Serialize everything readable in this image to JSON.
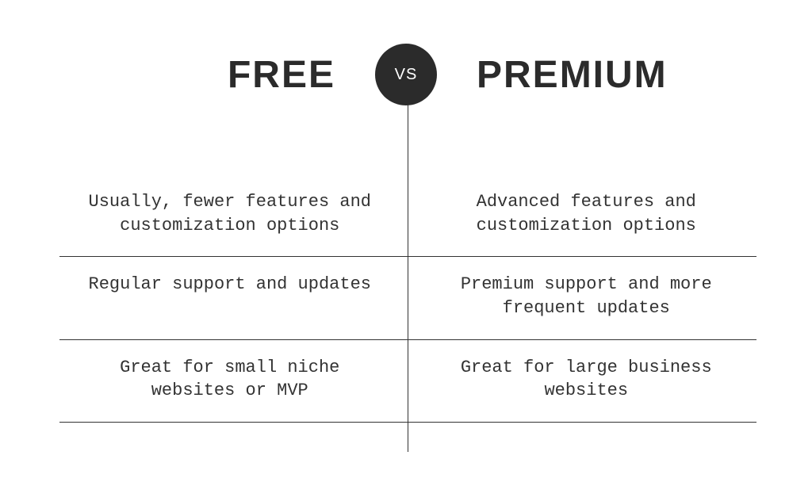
{
  "header": {
    "left": "FREE",
    "right": "PREMIUM",
    "vs": "VS"
  },
  "rows": [
    {
      "left": "Usually, fewer features and customization options",
      "right": "Advanced features and customization options"
    },
    {
      "left": "Regular support and updates",
      "right": "Premium support and more frequent updates"
    },
    {
      "left": "Great for small niche websites or MVP",
      "right": "Great for large business websites"
    }
  ]
}
